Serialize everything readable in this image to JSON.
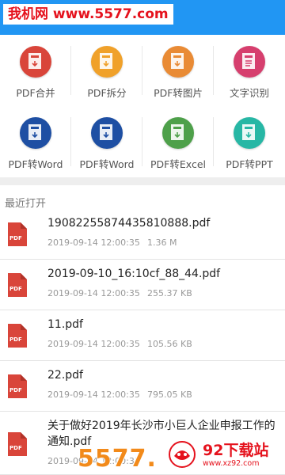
{
  "watermark_top": "我机网 www.5577.com",
  "tools": [
    {
      "label": "PDF合并",
      "icon": "pdf-merge-icon",
      "color": "#d9453a"
    },
    {
      "label": "PDF拆分",
      "icon": "pdf-split-icon",
      "color": "#f0a12a"
    },
    {
      "label": "PDF转图片",
      "icon": "pdf-to-image-icon",
      "color": "#e98b35"
    },
    {
      "label": "文字识别",
      "icon": "ocr-icon",
      "color": "#d63f6e"
    },
    {
      "label": "PDF转Word",
      "icon": "pdf-to-word-icon",
      "color": "#1e4fa3"
    },
    {
      "label": "PDF转Word",
      "icon": "pdf-to-word-icon",
      "color": "#1e4fa3"
    },
    {
      "label": "PDF转Excel",
      "icon": "pdf-to-excel-icon",
      "color": "#4ea04a"
    },
    {
      "label": "PDF转PPT",
      "icon": "pdf-to-ppt-icon",
      "color": "#27b7a5"
    }
  ],
  "recent": {
    "title": "最近打开",
    "files": [
      {
        "name": "19082255874435810888.pdf",
        "date": "2019-09-14 12:00:35",
        "size": "1.36 M"
      },
      {
        "name": "2019-09-10_16:10cf_88_44.pdf",
        "date": "2019-09-14 12:00:35",
        "size": "255.37 KB"
      },
      {
        "name": "11.pdf",
        "date": "2019-09-14 12:00:35",
        "size": "105.56 KB"
      },
      {
        "name": "22.pdf",
        "date": "2019-09-14 12:00:35",
        "size": "795.05 KB"
      },
      {
        "name": "关于做好2019年长沙市小巨人企业申报工作的通知.pdf",
        "date": "2019-09-14 12:00:35",
        "size": ""
      }
    ]
  },
  "watermark_bottom": {
    "left": "5577.",
    "right_title": "92下载站",
    "right_url": "www.xz92.com"
  },
  "colors": {
    "header": "#2196f3",
    "pdf_icon": "#d9453a"
  }
}
